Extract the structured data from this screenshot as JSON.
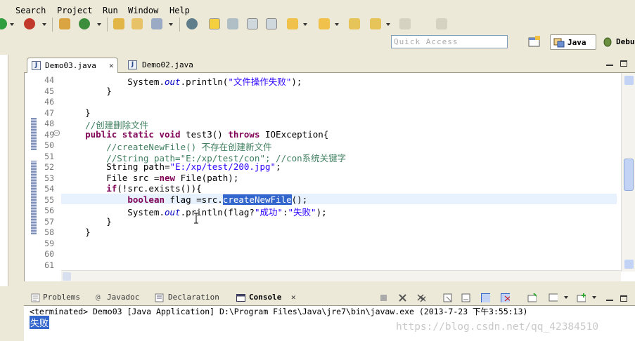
{
  "menu": [
    "Search",
    "Project",
    "Run",
    "Window",
    "Help"
  ],
  "toolbar": {
    "quick_access_placeholder": "Quick Access",
    "perspective_java": "Java",
    "perspective_debug": "Debu"
  },
  "editor": {
    "tabs": [
      {
        "label": "Demo03.java",
        "active": true
      },
      {
        "label": "Demo02.java",
        "active": false
      }
    ],
    "lines": [
      {
        "n": "44",
        "parts": [
          {
            "t": "            System."
          },
          {
            "t": "out",
            "c": "it"
          },
          {
            "t": ".println("
          },
          {
            "t": "\"文件操作失败\"",
            "c": "str"
          },
          {
            "t": ");"
          }
        ]
      },
      {
        "n": "45",
        "parts": [
          {
            "t": "        }"
          }
        ]
      },
      {
        "n": "46",
        "parts": [
          {
            "t": ""
          }
        ]
      },
      {
        "n": "47",
        "parts": [
          {
            "t": "    }"
          }
        ]
      },
      {
        "n": "48",
        "parts": [
          {
            "t": "    "
          },
          {
            "t": "//创建删除文件",
            "c": "cm"
          }
        ]
      },
      {
        "n": "49",
        "parts": [
          {
            "t": "    "
          },
          {
            "t": "public static void",
            "c": "kw"
          },
          {
            "t": " test3() "
          },
          {
            "t": "throws",
            "c": "kw"
          },
          {
            "t": " IOException{"
          }
        ]
      },
      {
        "n": "50",
        "parts": [
          {
            "t": "        "
          },
          {
            "t": "//createNewFile() 不存在创建新文件",
            "c": "cm"
          }
        ]
      },
      {
        "n": "51",
        "parts": [
          {
            "t": "        "
          },
          {
            "t": "//String path=\"E:/xp/test/con\"; //con系统关键字",
            "c": "cm"
          }
        ]
      },
      {
        "n": "52",
        "parts": [
          {
            "t": "        String path="
          },
          {
            "t": "\"E:/xp/test/200.jpg\"",
            "c": "str"
          },
          {
            "t": ";"
          }
        ]
      },
      {
        "n": "53",
        "parts": [
          {
            "t": "        File src ="
          },
          {
            "t": "new",
            "c": "kw"
          },
          {
            "t": " File(path);"
          }
        ]
      },
      {
        "n": "54",
        "parts": [
          {
            "t": "        "
          },
          {
            "t": "if",
            "c": "kw"
          },
          {
            "t": "(!src.exists()){"
          }
        ]
      },
      {
        "n": "55",
        "parts": [
          {
            "t": "            "
          },
          {
            "t": "boolean",
            "c": "kw"
          },
          {
            "t": " flag =src."
          },
          {
            "t": "createNewFile",
            "c": "sel"
          },
          {
            "t": "();"
          }
        ]
      },
      {
        "n": "56",
        "parts": [
          {
            "t": "            System."
          },
          {
            "t": "out",
            "c": "it"
          },
          {
            "t": ".println(flag?"
          },
          {
            "t": "\"成功\"",
            "c": "str"
          },
          {
            "t": ":"
          },
          {
            "t": "\"失败\"",
            "c": "str"
          },
          {
            "t": ");"
          }
        ]
      },
      {
        "n": "57",
        "parts": [
          {
            "t": "        }"
          }
        ]
      },
      {
        "n": "58",
        "parts": [
          {
            "t": "    }"
          }
        ]
      },
      {
        "n": "59",
        "parts": [
          {
            "t": ""
          }
        ]
      },
      {
        "n": "60",
        "parts": [
          {
            "t": ""
          }
        ]
      },
      {
        "n": "61",
        "parts": [
          {
            "t": ""
          }
        ]
      }
    ]
  },
  "console": {
    "tabs": [
      {
        "label": "Problems",
        "active": false
      },
      {
        "label": "Javadoc",
        "active": false
      },
      {
        "label": "Declaration",
        "active": false
      },
      {
        "label": "Console",
        "active": true
      }
    ],
    "terminated_line": "<terminated> Demo03 [Java Application] D:\\Program Files\\Java\\jre7\\bin\\javaw.exe (2013-7-23 下午3:55:13)",
    "output": "失败"
  },
  "watermark": "https://blog.csdn.net/qq_42384510",
  "colors": {
    "keyword": "#7f0055",
    "string": "#2a00ff",
    "comment": "#3f7f5f",
    "selection": "#3366cc",
    "background": "#ece9d8"
  }
}
